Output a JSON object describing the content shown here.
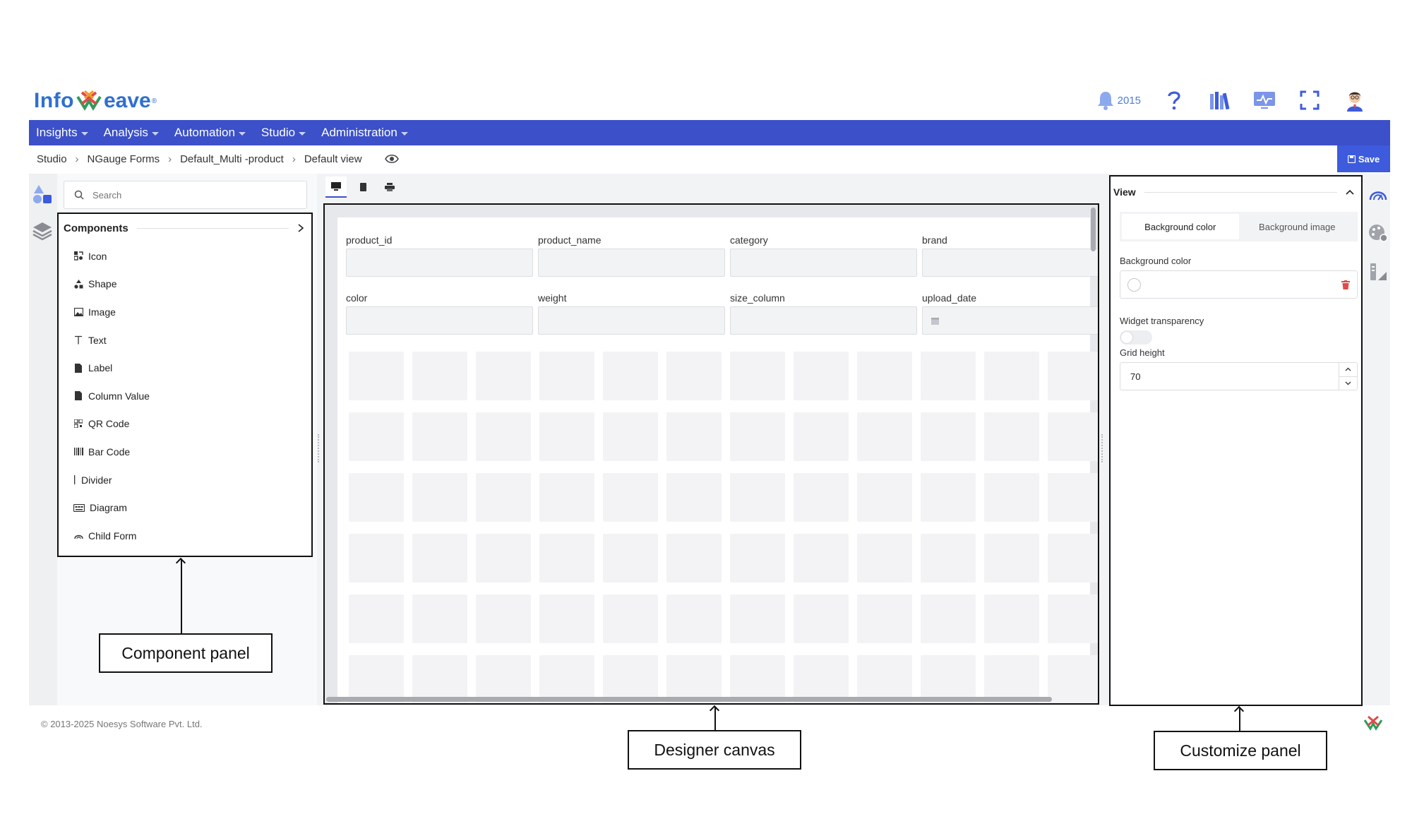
{
  "brand": {
    "logo_part1": "Info",
    "logo_part2": "eave",
    "logo_reg": "®"
  },
  "header": {
    "notification_count": "2015"
  },
  "nav": {
    "items": [
      "Insights",
      "Analysis",
      "Automation",
      "Studio",
      "Administration"
    ]
  },
  "breadcrumb": {
    "items": [
      "Studio",
      "NGauge Forms",
      "Default_Multi -product",
      "Default view"
    ]
  },
  "toolbar": {
    "save_label": "Save"
  },
  "search": {
    "placeholder": "Search"
  },
  "components": {
    "title": "Components",
    "items": [
      "Icon",
      "Shape",
      "Image",
      "Text",
      "Label",
      "Column Value",
      "QR Code",
      "Bar Code",
      "Divider",
      "Diagram",
      "Child Form"
    ]
  },
  "canvas": {
    "fields": [
      "product_id",
      "product_name",
      "category",
      "brand",
      "color",
      "weight",
      "size_column",
      "upload_date"
    ]
  },
  "customize": {
    "section_title": "View",
    "tabs": [
      "Background color",
      "Background image"
    ],
    "background_color_label": "Background color",
    "transparency_label": "Widget transparency",
    "grid_height_label": "Grid height",
    "grid_height_value": "70"
  },
  "footer": {
    "copyright": "© 2013-2025 Noesys Software Pvt. Ltd."
  },
  "callouts": {
    "component_panel": "Component panel",
    "designer_canvas": "Designer canvas",
    "customize_panel": "Customize panel"
  },
  "colors": {
    "nav_bar": "#3b50c9",
    "save_button": "#3d5bdc",
    "brand_blue": "#2f6fd0",
    "delete_red": "#e04b4b"
  }
}
